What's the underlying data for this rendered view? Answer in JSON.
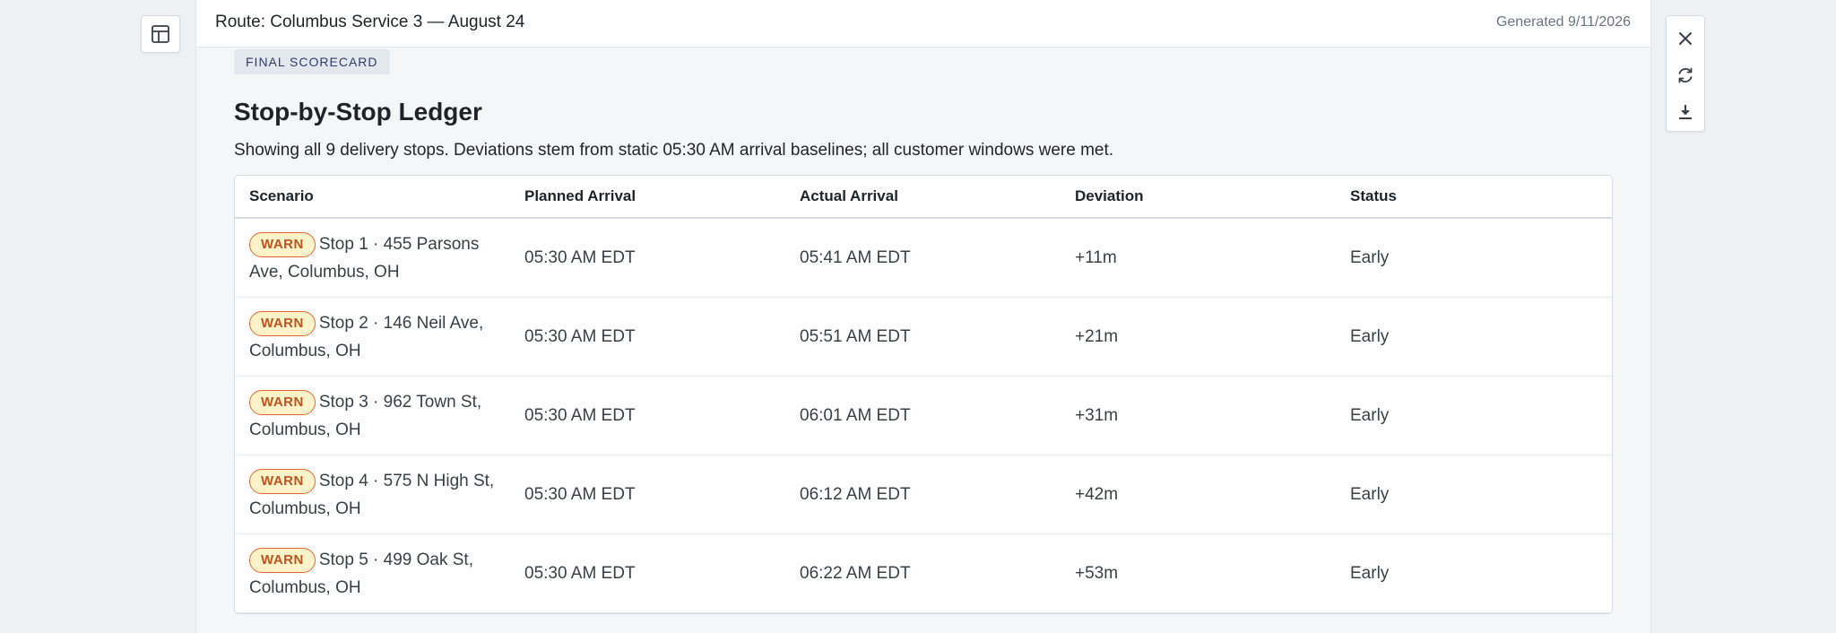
{
  "sidebar": {
    "toggle_icon": "layout-panel-icon"
  },
  "header": {
    "route_title": "Route: Columbus Service 3 — August 24",
    "generated": "Generated 9/11/2026"
  },
  "report": {
    "badge": "FINAL SCORECARD",
    "heading": "Stop-by-Stop Ledger",
    "subtitle": "Showing all 9 delivery stops. Deviations stem from static 05:30 AM arrival baselines; all customer windows were met."
  },
  "table": {
    "columns": [
      "Scenario",
      "Planned Arrival",
      "Actual Arrival",
      "Deviation",
      "Status"
    ],
    "rows": [
      {
        "tag": "WARN",
        "scenario": "Stop 1 · 455 Parsons Ave, Columbus, OH",
        "planned": "05:30 AM EDT",
        "actual": "05:41 AM EDT",
        "deviation": "+11m",
        "status": "Early"
      },
      {
        "tag": "WARN",
        "scenario": "Stop 2 · 146 Neil Ave, Columbus, OH",
        "planned": "05:30 AM EDT",
        "actual": "05:51 AM EDT",
        "deviation": "+21m",
        "status": "Early"
      },
      {
        "tag": "WARN",
        "scenario": "Stop 3 · 962 Town St, Columbus, OH",
        "planned": "05:30 AM EDT",
        "actual": "06:01 AM EDT",
        "deviation": "+31m",
        "status": "Early"
      },
      {
        "tag": "WARN",
        "scenario": "Stop 4 · 575 N High St, Columbus, OH",
        "planned": "05:30 AM EDT",
        "actual": "06:12 AM EDT",
        "deviation": "+42m",
        "status": "Early"
      },
      {
        "tag": "WARN",
        "scenario": "Stop 5 · 499 Oak St, Columbus, OH",
        "planned": "05:30 AM EDT",
        "actual": "06:22 AM EDT",
        "deviation": "+53m",
        "status": "Early"
      }
    ]
  },
  "toolbar": {
    "icons": [
      "close-icon",
      "refresh-icon",
      "download-icon"
    ]
  },
  "colors": {
    "warn_text": "#c0541d",
    "warn_border": "#e36a2f",
    "warn_bg": "#fdf2c8",
    "badge_bg": "#e3e7ee",
    "badge_text": "#2c3e6b"
  }
}
